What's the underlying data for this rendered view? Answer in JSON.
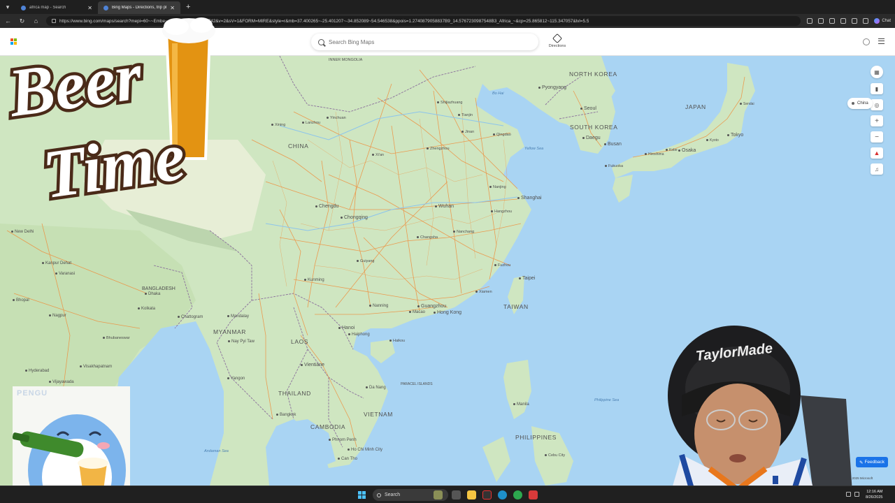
{
  "browser": {
    "tabs": [
      {
        "title": "africa map - Search",
        "active": false
      },
      {
        "title": "Bing Maps - Directions, trip planni",
        "active": true
      }
    ],
    "url": "https://www.bing.com/maps/search?mepi=60~~Embe~~~~k&ty=18&vdpid=742&v=2&sV=1&FORM=MIRE&style=r&mb=37.400265~-25.401207~-34.852089~54.546538&ppois=1.2740879058837B9_14.5767230987548B3_Africa_~&cp=25.865812~115.347057&lvl=5.5",
    "chat_label": "Chat"
  },
  "bing": {
    "search_placeholder": "Search Bing Maps",
    "directions_label": "Directions",
    "location_chip": "China",
    "feedback_label": "Feedback",
    "scale_text": "© 2025 Microsoft"
  },
  "map": {
    "countries": [
      {
        "text": "CHINA"
      },
      {
        "text": "NORTH KOREA"
      },
      {
        "text": "SOUTH KOREA"
      },
      {
        "text": "JAPAN"
      },
      {
        "text": "MYANMAR"
      },
      {
        "text": "LAOS"
      },
      {
        "text": "THAILAND"
      },
      {
        "text": "VIETNAM"
      },
      {
        "text": "CAMBODIA"
      },
      {
        "text": "PHILIPPINES"
      },
      {
        "text": "TAIWAN"
      },
      {
        "text": "BANGLADESH"
      },
      {
        "text": "INNER MONGOLIA"
      },
      {
        "text": "PARACEL ISLANDS"
      }
    ],
    "cities": [
      {
        "text": "Pyongyang"
      },
      {
        "text": "Seoul"
      },
      {
        "text": "Busan"
      },
      {
        "text": "Daegu"
      },
      {
        "text": "Tokyo"
      },
      {
        "text": "Osaka"
      },
      {
        "text": "Kobe"
      },
      {
        "text": "Fukuoka"
      },
      {
        "text": "Hiroshima"
      },
      {
        "text": "Sendai"
      },
      {
        "text": "Kyoto"
      },
      {
        "text": "Shanghai"
      },
      {
        "text": "Nanjing"
      },
      {
        "text": "Hangzhou"
      },
      {
        "text": "Wuhan"
      },
      {
        "text": "Chongqing"
      },
      {
        "text": "Chengdu"
      },
      {
        "text": "Guangzhou"
      },
      {
        "text": "Hong Kong"
      },
      {
        "text": "Macao"
      },
      {
        "text": "Xiamen"
      },
      {
        "text": "Fuzhou"
      },
      {
        "text": "Taipei"
      },
      {
        "text": "Zhengzhou"
      },
      {
        "text": "Xi'an"
      },
      {
        "text": "Tianjin"
      },
      {
        "text": "Shijiazhuang"
      },
      {
        "text": "Jinan"
      },
      {
        "text": "Qingdao"
      },
      {
        "text": "Kunming"
      },
      {
        "text": "Nanning"
      },
      {
        "text": "Haikou"
      },
      {
        "text": "Hanoi"
      },
      {
        "text": "Haiphong"
      },
      {
        "text": "Da Nang"
      },
      {
        "text": "Vientiane"
      },
      {
        "text": "Bangkok"
      },
      {
        "text": "Phnom Penh"
      },
      {
        "text": "Ho Chi Minh City"
      },
      {
        "text": "Can Tho"
      },
      {
        "text": "Yangon"
      },
      {
        "text": "Mandalay"
      },
      {
        "text": "Nay Pyi Taw"
      },
      {
        "text": "Chattogram"
      },
      {
        "text": "Dhaka"
      },
      {
        "text": "Kolkata"
      },
      {
        "text": "New Delhi"
      },
      {
        "text": "Kanpur Dehat"
      },
      {
        "text": "Varanasi"
      },
      {
        "text": "Bhopal"
      },
      {
        "text": "Nagpur"
      },
      {
        "text": "Hyderabad"
      },
      {
        "text": "Visakhapatnam"
      },
      {
        "text": "Vijayawada"
      },
      {
        "text": "Bhubaneswar"
      },
      {
        "text": "Manila"
      },
      {
        "text": "Cebu City"
      },
      {
        "text": "Lanzhou"
      },
      {
        "text": "Xining"
      },
      {
        "text": "Yinchuan"
      },
      {
        "text": "Changsha"
      },
      {
        "text": "Nanchang"
      },
      {
        "text": "Guiyang"
      }
    ],
    "seas": [
      {
        "text": "Yellow Sea"
      },
      {
        "text": "Philippine Sea"
      },
      {
        "text": "Andaman Sea"
      },
      {
        "text": "Bo Hai"
      }
    ]
  },
  "overlays": {
    "beer_text_1": "Beer",
    "beer_text_2": "Time",
    "penguin_watermark": "PENGU",
    "cap_text": "TaylorMade"
  },
  "taskbar": {
    "search_label": "Search",
    "time": "12:16 AM",
    "date": "8/26/2025"
  },
  "colors": {
    "water": "#a9d4f3",
    "land": "#cfe6c1",
    "road": "#ef8d3c",
    "border": "#8a6f9b",
    "accent": "#1a73e8"
  }
}
